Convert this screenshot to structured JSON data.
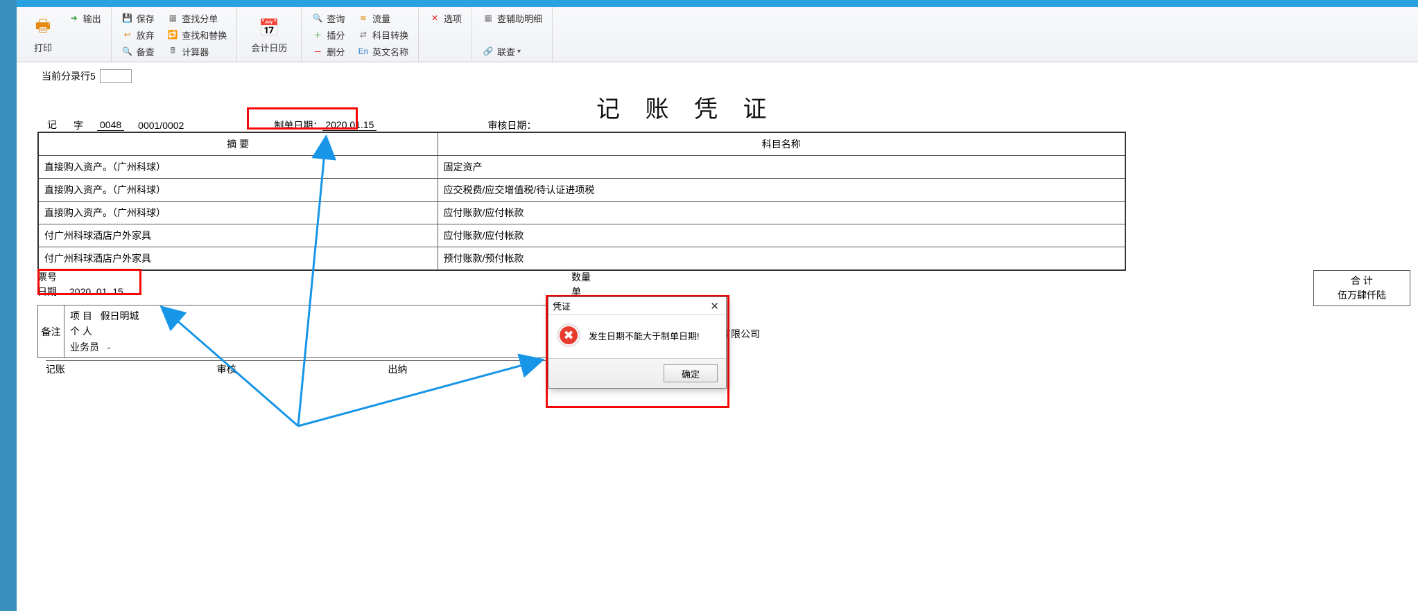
{
  "ribbon": {
    "print": "打印",
    "export": "输出",
    "save": "保存",
    "abandon": "放弃",
    "backup": "备查",
    "find_entry": "查找分单",
    "find_replace": "查找和替换",
    "calculator": "计算器",
    "acc_calendar": "会计日历",
    "query": "查询",
    "insert_entry": "插分",
    "delete_entry": "删分",
    "flow": "流量",
    "subject_convert": "科目转换",
    "english_name": "英文名称",
    "options": "选项",
    "assist_detail": "查辅助明细",
    "link_query": "联查"
  },
  "info": {
    "label": "当前分录行5"
  },
  "doc": {
    "title": "记 账 凭 证"
  },
  "header": {
    "char": "记",
    "zi": "字",
    "number": "0048",
    "seq": "0001/0002",
    "make_date_label": "制单日期：",
    "make_date": "2020.01.15",
    "audit_date_label": "审核日期："
  },
  "table": {
    "col_summary": "摘 要",
    "col_subject": "科目名称",
    "rows": [
      {
        "summary": "直接购入资产。（广州科球）",
        "subject": "固定资产"
      },
      {
        "summary": "直接购入资产。（广州科球）",
        "subject": "应交税费/应交增值税/待认证进项税"
      },
      {
        "summary": "直接购入资产。（广州科球）",
        "subject": "应付账款/应付帐款"
      },
      {
        "summary": "付广州科球酒店户外家具",
        "subject": "应付账款/应付帐款"
      },
      {
        "summary": "付广州科球酒店户外家具",
        "subject": "预付账款/预付帐款"
      }
    ]
  },
  "lower": {
    "ticket_label": "票号",
    "date_label": "日期",
    "date_value": "2020. 01. 15",
    "qty_label": "数量",
    "unit_label": "单",
    "total_label": "合 计",
    "amount_cn": "伍万肆仟陆"
  },
  "remark": {
    "label": "备注",
    "project_label": "项 目",
    "project_value": "假日明城",
    "person_label": "个 人",
    "staff_label": "业务员",
    "staff_value": "-"
  },
  "company": {
    "suffix": "有限公司"
  },
  "footer": {
    "jz": "记账",
    "sh": "审核",
    "cn": "出纳"
  },
  "dialog": {
    "title": "凭证",
    "message": "发生日期不能大于制单日期!",
    "ok": "确定"
  }
}
